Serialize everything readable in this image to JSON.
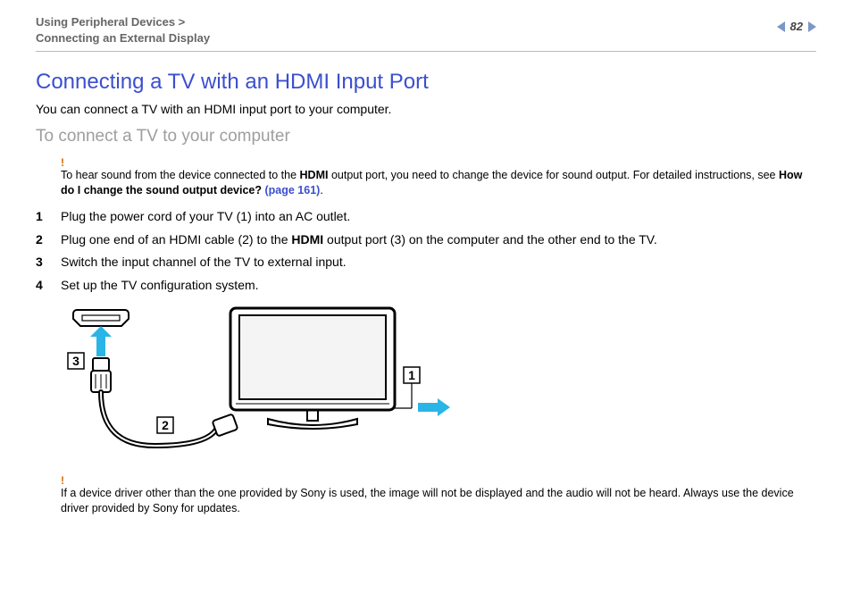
{
  "header": {
    "breadcrumb_line1": "Using Peripheral Devices >",
    "breadcrumb_line2": "Connecting an External Display",
    "page_number": "82"
  },
  "title": "Connecting a TV with an HDMI Input Port",
  "intro": "You can connect a TV with an HDMI input port to your computer.",
  "subtitle": "To connect a TV to your computer",
  "note1": {
    "bang": "!",
    "pre": "To hear sound from the device connected to the ",
    "hdmi": "HDMI",
    "mid": " output port, you need to change the device for sound output. For detailed instructions, see ",
    "linklead": "How do I change the sound output device? ",
    "linkpage": "(page 161)",
    "tail": "."
  },
  "steps": [
    {
      "n": "1",
      "text": "Plug the power cord of your TV (1) into an AC outlet."
    },
    {
      "n": "2",
      "pre": "Plug one end of an HDMI cable (2) to the ",
      "strong": "HDMI",
      "post": " output port (3) on the computer and the other end to the TV."
    },
    {
      "n": "3",
      "text": "Switch the input channel of the TV to external input."
    },
    {
      "n": "4",
      "text": "Set up the TV configuration system."
    }
  ],
  "diagram": {
    "labels": {
      "one": "1",
      "two": "2",
      "three": "3"
    }
  },
  "note2": {
    "bang": "!",
    "text": "If a device driver other than the one provided by Sony is used, the image will not be displayed and the audio will not be heard. Always use the device driver provided by Sony for updates."
  }
}
